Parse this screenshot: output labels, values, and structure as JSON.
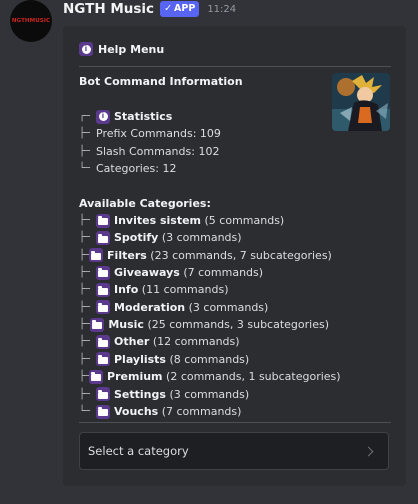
{
  "message": {
    "username": "NGTH Music",
    "app_badge": "APP",
    "timestamp": "11:24",
    "avatar_text": "NGTHMUSIC"
  },
  "embed": {
    "author": "Help Menu",
    "title": "Bot Command Information",
    "stats": {
      "heading": "Statistics",
      "lines": [
        {
          "tree": "├─",
          "text": "Prefix Commands: 109"
        },
        {
          "tree": "├─",
          "text": "Slash Commands: 102"
        },
        {
          "tree": "└─",
          "text": "Categories: 12"
        }
      ],
      "head_tree": "┌─"
    },
    "categories_heading": "Available Categories:",
    "categories": [
      {
        "tree": "├─",
        "name": "Invites sistem",
        "detail": "(5 commands)"
      },
      {
        "tree": "├─",
        "name": "Spotify",
        "detail": "(3 commands)"
      },
      {
        "tree": "├─",
        "name": "Filters",
        "detail": "(23 commands, 7 subcategories)"
      },
      {
        "tree": "├─",
        "name": "Giveaways",
        "detail": "(7 commands)"
      },
      {
        "tree": "├─",
        "name": "Info",
        "detail": "(11 commands)"
      },
      {
        "tree": "├─",
        "name": "Moderation",
        "detail": "(3 commands)"
      },
      {
        "tree": "├─",
        "name": "Music",
        "detail": "(25 commands, 3 subcategories)"
      },
      {
        "tree": "├─",
        "name": "Other",
        "detail": "(12 commands)"
      },
      {
        "tree": "├─",
        "name": "Playlists",
        "detail": "(8 commands)"
      },
      {
        "tree": "├─",
        "name": "Premium",
        "detail": "(2 commands, 1 subcategories)"
      },
      {
        "tree": "├─",
        "name": "Settings",
        "detail": "(3 commands)"
      },
      {
        "tree": "└─",
        "name": "Vouchs",
        "detail": "(7 commands)"
      }
    ],
    "select_placeholder": "Select a category"
  },
  "colors": {
    "background": "#313338",
    "embed": "#2b2d31",
    "accent": "#5865f2",
    "emoji_purple": "#5b3a8e"
  }
}
